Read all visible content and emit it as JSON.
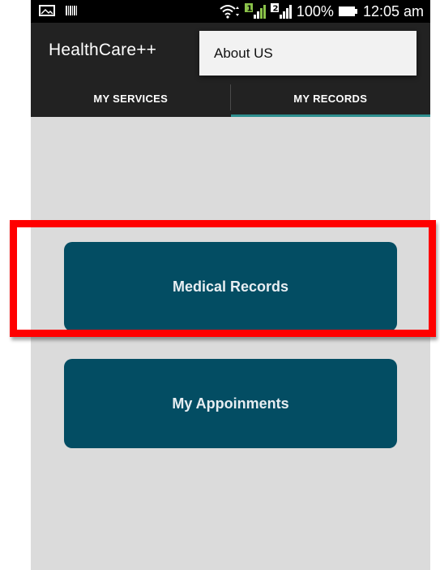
{
  "status_bar": {
    "battery_percent": "100%",
    "time": "12:05 am",
    "sim1_label": "1",
    "sim2_label": "2",
    "icons": [
      "gallery-icon",
      "barcode-icon",
      "wifi-icon",
      "signal-sim1-icon",
      "signal-sim2-icon",
      "battery-icon"
    ]
  },
  "action_bar": {
    "title": "HealthCare++"
  },
  "menu": {
    "items": [
      {
        "label": "About US"
      }
    ]
  },
  "tabs": [
    {
      "label": "MY SERVICES",
      "selected": false
    },
    {
      "label": "MY RECORDS",
      "selected": true
    }
  ],
  "buttons": {
    "medical_records": "Medical Records",
    "my_appointments": "My Appoinments"
  },
  "colors": {
    "status_bar": "#000000",
    "action_bar": "#222222",
    "tab_indicator": "#2e8f8f",
    "button_bg": "#034d63",
    "content_bg": "#dbdbdb",
    "highlight": "#ff0000",
    "sim_signal": "#8bc34a"
  }
}
